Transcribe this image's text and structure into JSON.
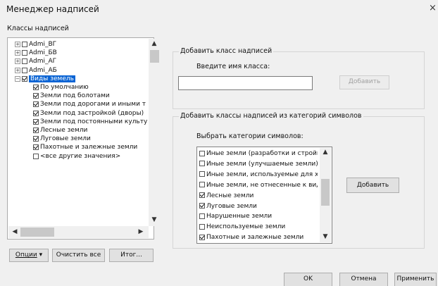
{
  "window": {
    "title": "Менеджер надписей",
    "close_glyph": "×"
  },
  "classes_label": "Классы надписей",
  "tree": {
    "items": [
      {
        "label": "Admi_ВГ",
        "checked": false,
        "level": 0
      },
      {
        "label": "Admi_БВ",
        "checked": false,
        "level": 0
      },
      {
        "label": "Admi_АГ",
        "checked": false,
        "level": 0
      },
      {
        "label": "Admi_АБ",
        "checked": false,
        "level": 0
      },
      {
        "label": "Виды земель",
        "checked": true,
        "level": 0,
        "selected": true
      },
      {
        "label": "По умолчанию",
        "checked": true,
        "level": 1
      },
      {
        "label": "Земли под болотами",
        "checked": true,
        "level": 1
      },
      {
        "label": "Земли под дорогами и иными т",
        "checked": true,
        "level": 1
      },
      {
        "label": "Земли под застройкой (дворы)",
        "checked": true,
        "level": 1
      },
      {
        "label": "Земли под постоянными культу",
        "checked": true,
        "level": 1
      },
      {
        "label": "Лесные земли",
        "checked": true,
        "level": 1
      },
      {
        "label": "Луговые земли",
        "checked": true,
        "level": 1
      },
      {
        "label": "Пахотные и залежные земли",
        "checked": true,
        "level": 1
      },
      {
        "label": "<все другие значения>",
        "checked": false,
        "level": 1
      }
    ]
  },
  "left_buttons": {
    "options": "Опции",
    "options_chevron": "▾",
    "clear_all": "Очистить все",
    "summary": "Итог..."
  },
  "add_class": {
    "group_title": "Добавить класс надписей",
    "prompt": "Введите имя класса:",
    "input_value": "",
    "add_button": "Добавить"
  },
  "add_from_categories": {
    "group_title": "Добавить классы надписей из категорий символов",
    "prompt": "Выбрать категории символов:",
    "items": [
      {
        "label": "Иные земли (разработки и стройплс",
        "checked": false
      },
      {
        "label": "Иные земли (улучшаемые земли)",
        "checked": false
      },
      {
        "label": "Иные земли, используемые для хра",
        "checked": false
      },
      {
        "label": "Иные земли, не отнесенные к видам",
        "checked": false
      },
      {
        "label": "Лесные земли",
        "checked": true
      },
      {
        "label": "Луговые земли",
        "checked": true
      },
      {
        "label": "Нарушенные земли",
        "checked": false
      },
      {
        "label": "Неиспользуемые земли",
        "checked": false
      },
      {
        "label": "Пахотные и залежные земли",
        "checked": true
      }
    ],
    "add_button": "Добавить"
  },
  "footer": {
    "ok": "OK",
    "cancel": "Отмена",
    "apply": "Применить"
  },
  "icons": {
    "scroll_up": "▲",
    "scroll_down": "▼",
    "scroll_left": "◀",
    "scroll_right": "▶"
  }
}
